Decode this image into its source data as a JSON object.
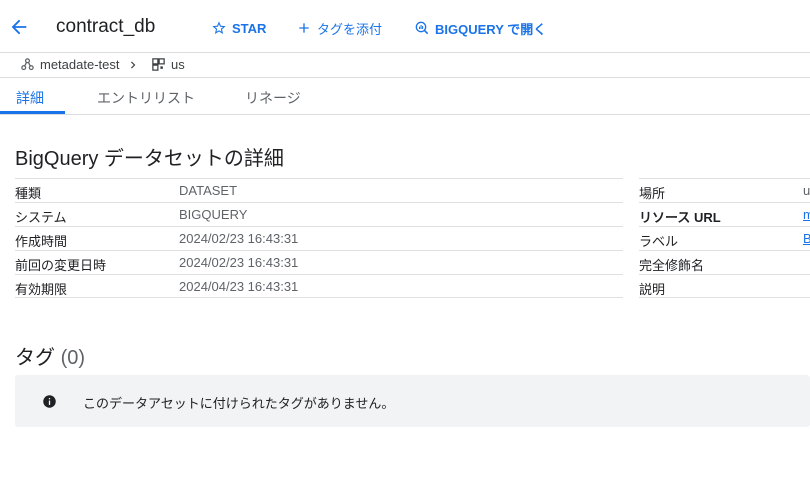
{
  "header": {
    "title": "contract_db",
    "actions": [
      {
        "label": "STAR",
        "icon": "star-outline-icon"
      },
      {
        "label": "タグを添付",
        "icon": "plus-icon"
      },
      {
        "label": "BIGQUERY で開く",
        "icon": "bigquery-icon"
      }
    ]
  },
  "breadcrumb": {
    "project": "metadate-test",
    "location": "us"
  },
  "tabs": [
    {
      "label": "詳細",
      "active": true
    },
    {
      "label": "エントリリスト",
      "active": false
    },
    {
      "label": "リネージ",
      "active": false
    }
  ],
  "details": {
    "title": "BigQuery データセットの詳細",
    "left": [
      {
        "key": "種類",
        "value": "DATASET"
      },
      {
        "key": "システム",
        "value": "BIGQUERY"
      },
      {
        "key": "作成時間",
        "value": "2024/02/23 16:43:31"
      },
      {
        "key": "前回の変更日時",
        "value": "2024/02/23 16:43:31"
      },
      {
        "key": "有効期限",
        "value": "2024/04/23 16:43:31"
      }
    ],
    "right": [
      {
        "key": "場所",
        "value": "u"
      },
      {
        "key": "リソース URL",
        "value": "m"
      },
      {
        "key": "ラベル",
        "value": "B"
      },
      {
        "key": "完全修飾名",
        "value": ""
      },
      {
        "key": "説明",
        "value": ""
      }
    ]
  },
  "tags": {
    "title": "タグ",
    "count": "(0)",
    "empty_message": "このデータアセットに付けられたタグがありません。"
  },
  "colors": {
    "accent": "#1a73e8",
    "info_bg": "#f1f3f4"
  }
}
